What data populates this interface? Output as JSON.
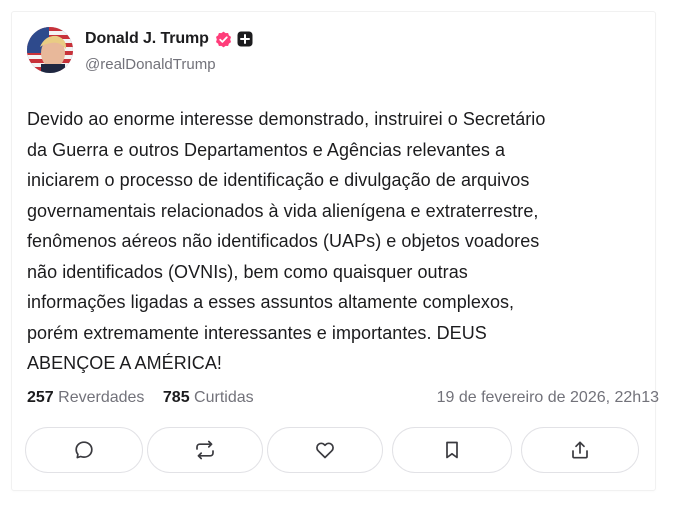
{
  "author": {
    "name": "Donald J. Trump",
    "handle": "@realDonaldTrump",
    "verified_icon": "verified-badge-icon",
    "extra_badge_icon": "plus-badge-icon",
    "verified_color": "#ff3d7a"
  },
  "post": {
    "lines": [
      "Devido ao enorme interesse demonstrado, instruirei o Secretário",
      "da Guerra e outros Departamentos e Agências relevantes a",
      "iniciarem o processo de identificação e divulgação de arquivos",
      "governamentais relacionados à vida alienígena e extraterrestre,",
      "fenômenos aéreos não identificados (UAPs) e objetos voadores",
      "não identificados (OVNIs), bem como quaisquer outras",
      "informações ligadas a esses assuntos altamente complexos,",
      "porém extremamente interessantes e importantes. DEUS",
      "ABENÇOE A AMÉRICA!"
    ]
  },
  "stats": {
    "reposts_count": "257",
    "reposts_label": "Reverdades",
    "likes_count": "785",
    "likes_label": "Curtidas",
    "timestamp": "19 de fevereiro de 2026, 22h13"
  },
  "actions": [
    {
      "icon": "reply-icon"
    },
    {
      "icon": "repost-icon"
    },
    {
      "icon": "heart-icon"
    },
    {
      "icon": "bookmark-icon"
    },
    {
      "icon": "share-icon"
    }
  ]
}
